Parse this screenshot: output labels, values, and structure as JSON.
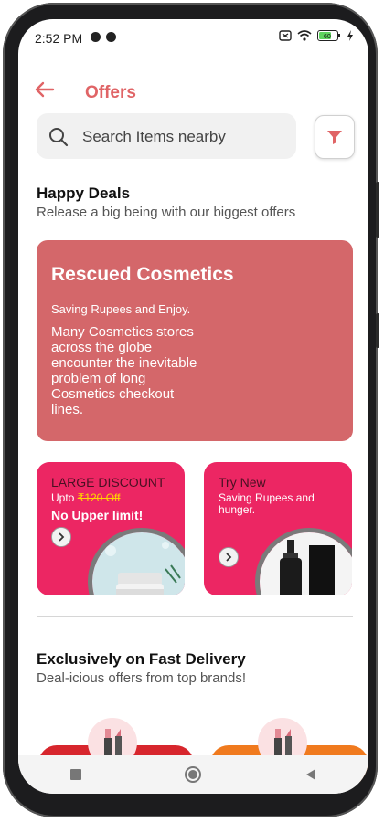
{
  "status_bar": {
    "time": "2:52 PM",
    "battery": "60"
  },
  "header": {
    "title": "Offers",
    "back_icon": "arrow-left-icon"
  },
  "search": {
    "placeholder": "Search Items nearby",
    "value": ""
  },
  "happy_deals": {
    "title": "Happy Deals",
    "subtitle": "Release a big being with our biggest offers",
    "hero": {
      "title": "Rescued Cosmetics",
      "tagline": "Saving Rupees and Enjoy.",
      "description": "Many Cosmetics stores across the globe encounter the inevitable problem of long Cosmetics checkout lines."
    },
    "cards": [
      {
        "heading": "LARGE DISCOUNT",
        "upto": "Upto",
        "price": "₹120 Off",
        "bold": "No Upper limit!"
      },
      {
        "heading": "Try New",
        "subtitle": "Saving Rupees and hunger."
      }
    ]
  },
  "fast_delivery": {
    "title": "Exclusively on Fast Delivery",
    "subtitle": "Deal-icious offers from top brands!"
  },
  "colors": {
    "accent": "#e06466",
    "hero_bg": "#d4676a",
    "card_bg": "#ec2663",
    "strike": "#ffd400"
  }
}
